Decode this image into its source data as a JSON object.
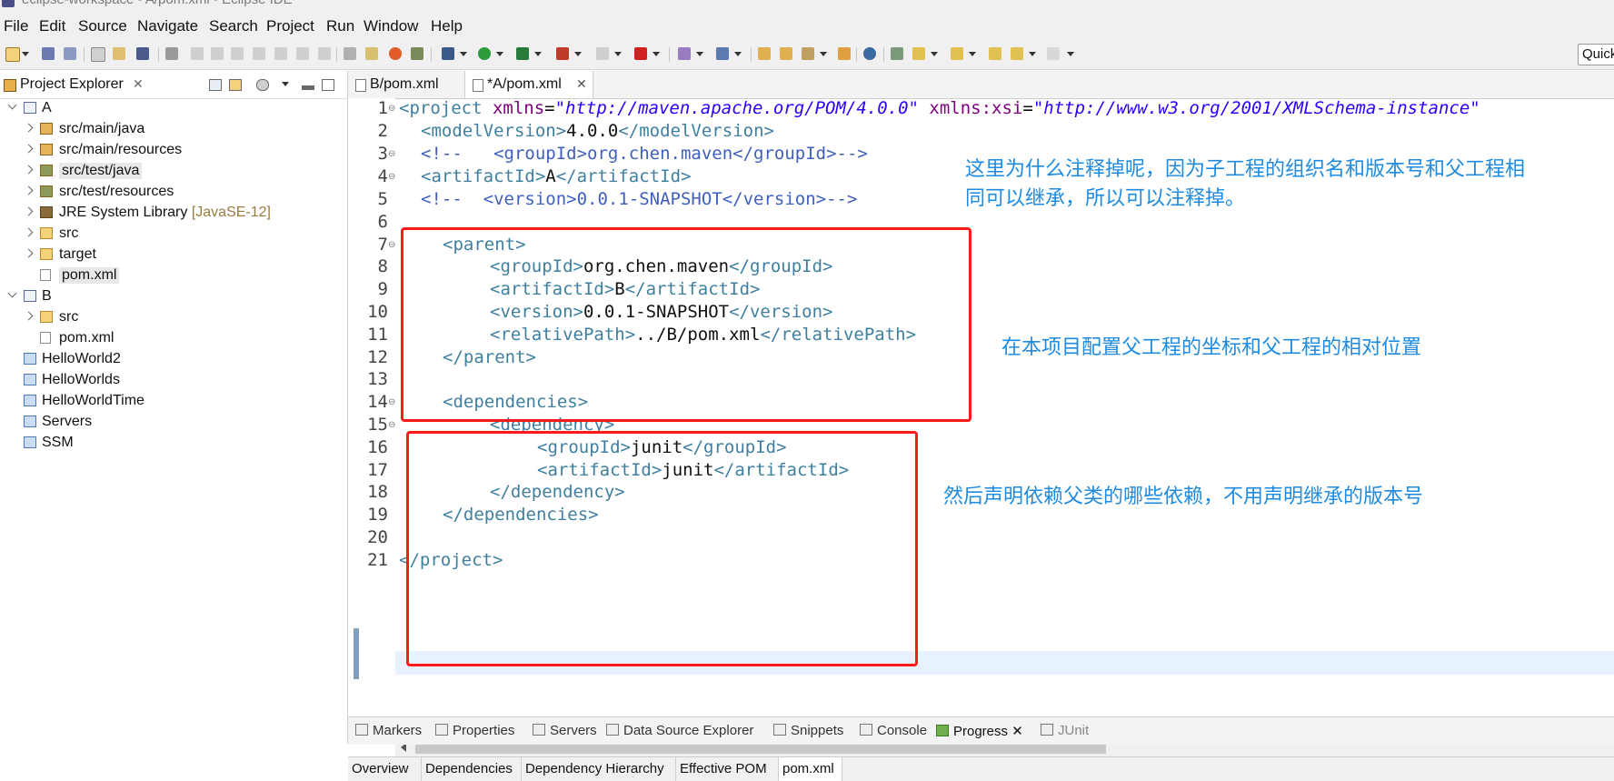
{
  "window": {
    "title": "eclipse-workspace - A/pom.xml - Eclipse IDE"
  },
  "menu": [
    "File",
    "Edit",
    "Source",
    "Navigate",
    "Search",
    "Project",
    "Run",
    "Window",
    "Help"
  ],
  "quick_access": {
    "text": "Quick"
  },
  "explorer": {
    "title": "Project Explorer",
    "close": "✕",
    "items": [
      {
        "label": "A",
        "decor": ""
      },
      {
        "label": "src/main/java",
        "decor": ""
      },
      {
        "label": "src/main/resources",
        "decor": ""
      },
      {
        "label": "src/test/java",
        "decor": ""
      },
      {
        "label": "src/test/resources",
        "decor": ""
      },
      {
        "label": "JRE System Library",
        "decor": "[JavaSE-12]"
      },
      {
        "label": "src",
        "decor": ""
      },
      {
        "label": "target",
        "decor": ""
      },
      {
        "label": "pom.xml",
        "decor": ""
      },
      {
        "label": "B",
        "decor": ""
      },
      {
        "label": "src",
        "decor": ""
      },
      {
        "label": "pom.xml",
        "decor": ""
      },
      {
        "label": "HelloWorld2",
        "decor": ""
      },
      {
        "label": "HelloWorlds",
        "decor": ""
      },
      {
        "label": "HelloWorldTime",
        "decor": ""
      },
      {
        "label": "Servers",
        "decor": ""
      },
      {
        "label": "SSM",
        "decor": ""
      }
    ]
  },
  "editor": {
    "tabs": [
      {
        "label": "B/pom.xml"
      },
      {
        "label": "*A/pom.xml",
        "close": "✕"
      }
    ],
    "line_numbers": [
      "1",
      "2",
      "3",
      "4",
      "5",
      "6",
      "7",
      "8",
      "9",
      "10",
      "11",
      "12",
      "13",
      "14",
      "15",
      "16",
      "17",
      "18",
      "19",
      "20",
      "21"
    ],
    "code": {
      "l1": {
        "t1": "<project",
        "a1": " xmlns",
        "e1": "=",
        "s1": "\"http://maven.apache.org/POM/4.0.0\"",
        "a2": " xmlns:xsi",
        "e2": "=",
        "s2": "\"http://www.w3.org/2001/XMLSchema-instance\""
      },
      "l2": {
        "o": "<modelVersion>",
        "v": "4.0.0",
        "c": "</modelVersion>"
      },
      "l3": "<!--   <groupId>org.chen.maven</groupId>-->",
      "l4": {
        "o": "<artifactId>",
        "v": "A",
        "c": "</artifactId>"
      },
      "l5": "<!--  <version>0.0.1-SNAPSHOT</version>-->",
      "l7": "<parent>",
      "l8": {
        "o": "<groupId>",
        "v": "org.chen.maven",
        "c": "</groupId>"
      },
      "l9": {
        "o": "<artifactId>",
        "v": "B",
        "c": "</artifactId>"
      },
      "l10": {
        "o": "<version>",
        "v": "0.0.1-SNAPSHOT",
        "c": "</version>"
      },
      "l11": {
        "o": "<relativePath>",
        "v": "../B/pom.xml",
        "c": "</relativePath>"
      },
      "l12": "</parent>",
      "l14": "<dependencies>",
      "l15": "<dependency>",
      "l16": {
        "o": "<groupId>",
        "v": "junit",
        "c": "</groupId>"
      },
      "l17": {
        "o": "<artifactId>",
        "v": "junit",
        "c": "</artifactId>"
      },
      "l18": "</dependency>",
      "l19": "</dependencies>",
      "l21": "</project>"
    },
    "annotations": {
      "a1": "这里为什么注释掉呢，因为子工程的组织名和版本号和父工程相",
      "a1b": "同可以继承，所以可以注释掉。",
      "a2": "在本项目配置父工程的坐标和父工程的相对位置",
      "a3": "然后声明依赖父类的哪些依赖，不用声明继承的版本号"
    },
    "pom_tabs": [
      "Overview",
      "Dependencies",
      "Dependency Hierarchy",
      "Effective POM",
      "pom.xml"
    ]
  },
  "bottom_views": [
    "Markers",
    "Properties",
    "Servers",
    "Data Source Explorer",
    "Snippets",
    "Console",
    "Progress",
    "JUnit"
  ],
  "bottom_views_close": "✕",
  "colors": {
    "annotation": "#1e8be0",
    "highlight_box": "#ff1a1a",
    "tag": "#3f7f9f",
    "attribute": "#7f007f",
    "string": "#2a00ff",
    "comment": "#3f5fbf"
  }
}
